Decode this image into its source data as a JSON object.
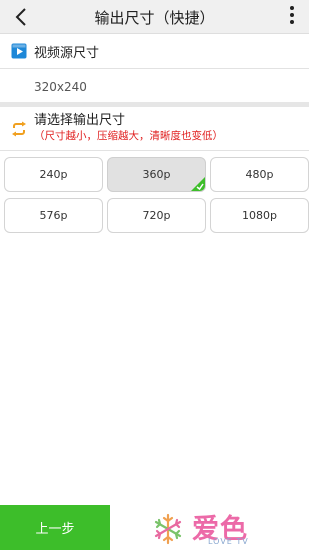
{
  "header": {
    "title": "输出尺寸（快捷）"
  },
  "source": {
    "label": "视频源尺寸",
    "value": "320x240"
  },
  "output": {
    "label": "请选择输出尺寸",
    "hint": "（尺寸越小，压缩越大，清晰度也变低）",
    "options": [
      {
        "label": "240p",
        "selected": false
      },
      {
        "label": "360p",
        "selected": true
      },
      {
        "label": "480p",
        "selected": false
      },
      {
        "label": "576p",
        "selected": false
      },
      {
        "label": "720p",
        "selected": false
      },
      {
        "label": "1080p",
        "selected": false
      }
    ]
  },
  "footer": {
    "prev_label": "上一步",
    "logo_text": "爱色",
    "logo_sub": "LOVE TV"
  },
  "colors": {
    "accent_green": "#3dbe2a",
    "hint_red": "#e02020",
    "video_icon_blue": "#1e88d8",
    "swap_icon_orange": "#f0a020"
  },
  "icons": [
    "back-arrow-icon",
    "more-vert-icon",
    "video-icon",
    "swap-icon",
    "check-corner-icon",
    "snowflake-icon"
  ]
}
